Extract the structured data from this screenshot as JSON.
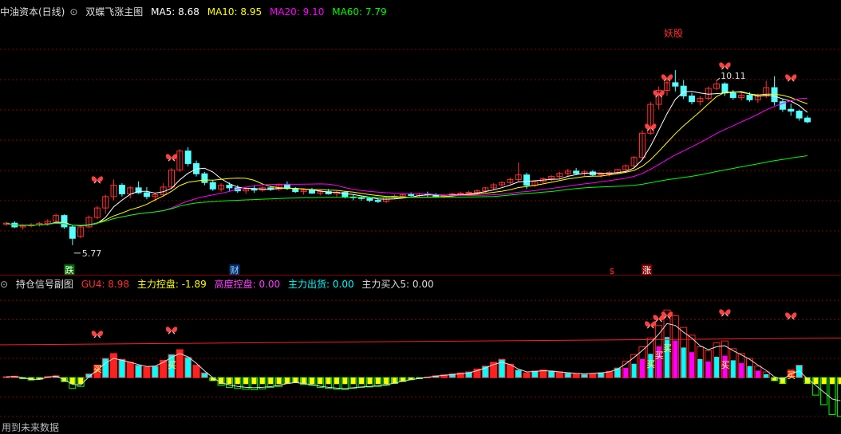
{
  "main_header": {
    "stock_name": "中油资本(日线)",
    "formula_name": "双蝶飞涨主图",
    "ma5": "MA5: 8.68",
    "ma10": "MA10: 8.95",
    "ma20": "MA20: 9.10",
    "ma60": "MA60: 7.79"
  },
  "sub_header": {
    "title": "持仓信号副图",
    "gu4": "GU4: 8.98",
    "ctrl": "主力控盘: -1.89",
    "high_ctrl": "高度控盘: 0.00",
    "ship": "主力出货: 0.00",
    "buy5": "主力买入5: 0.00"
  },
  "annotations": {
    "demon": "妖股",
    "high_label": "10.11",
    "low_label": "5.77",
    "die": "跌",
    "cai": "财",
    "dollar": "$",
    "zhang": "涨",
    "buy": "买"
  },
  "footer_note": "用到未来数据",
  "colors": {
    "up": "#ff3030",
    "down": "#54ffff",
    "ma5": "#ffffff",
    "ma10": "#ffff00",
    "ma20": "#ff00ff",
    "ma60": "#00ff00",
    "grid": "#8b0000",
    "butterfly": "#ff4040",
    "pos_bar": "#ff2020",
    "neg_bar": "#ffff00",
    "neg_outline": "#00ff00",
    "magenta_bar": "#ff00ff",
    "cyan_bar": "#00ffff"
  },
  "chart_data": [
    {
      "type": "candlestick",
      "title": "双蝶飞涨主图",
      "series_names": [
        "MA5",
        "MA10",
        "MA20",
        "MA60"
      ],
      "ylim": [
        5.2,
        11.6
      ],
      "high_marker": 10.11,
      "low_marker": 5.77,
      "candles": [
        [
          6.32,
          6.38,
          6.28,
          6.35
        ],
        [
          6.35,
          6.4,
          6.22,
          6.25
        ],
        [
          6.25,
          6.32,
          6.18,
          6.28
        ],
        [
          6.28,
          6.35,
          6.24,
          6.3
        ],
        [
          6.3,
          6.38,
          6.26,
          6.34
        ],
        [
          6.34,
          6.45,
          6.28,
          6.4
        ],
        [
          6.4,
          6.6,
          6.36,
          6.55
        ],
        [
          6.55,
          6.58,
          6.2,
          6.25
        ],
        [
          6.25,
          6.3,
          5.77,
          5.95
        ],
        [
          6.0,
          6.3,
          5.95,
          6.25
        ],
        [
          6.25,
          6.55,
          6.22,
          6.5
        ],
        [
          6.5,
          6.8,
          6.45,
          6.75
        ],
        [
          6.75,
          7.1,
          6.6,
          7.05
        ],
        [
          7.05,
          7.5,
          6.95,
          7.35
        ],
        [
          7.35,
          7.4,
          7.05,
          7.12
        ],
        [
          7.12,
          7.32,
          7.0,
          7.28
        ],
        [
          7.28,
          7.45,
          7.12,
          7.15
        ],
        [
          7.15,
          7.3,
          6.98,
          7.05
        ],
        [
          7.05,
          7.15,
          6.92,
          7.1
        ],
        [
          7.1,
          7.4,
          7.05,
          7.3
        ],
        [
          7.3,
          7.8,
          7.25,
          7.75
        ],
        [
          7.75,
          8.3,
          7.7,
          8.25
        ],
        [
          8.25,
          8.35,
          7.85,
          7.92
        ],
        [
          7.92,
          8.0,
          7.58,
          7.65
        ],
        [
          7.65,
          7.7,
          7.35,
          7.42
        ],
        [
          7.42,
          7.48,
          7.2,
          7.25
        ],
        [
          7.25,
          7.4,
          7.18,
          7.35
        ],
        [
          7.35,
          7.42,
          7.2,
          7.28
        ],
        [
          7.28,
          7.35,
          7.15,
          7.2
        ],
        [
          7.2,
          7.3,
          7.12,
          7.25
        ],
        [
          7.25,
          7.35,
          7.15,
          7.22
        ],
        [
          7.22,
          7.32,
          7.18,
          7.28
        ],
        [
          7.28,
          7.34,
          7.2,
          7.24
        ],
        [
          7.24,
          7.4,
          7.2,
          7.36
        ],
        [
          7.36,
          7.45,
          7.22,
          7.26
        ],
        [
          7.26,
          7.3,
          7.15,
          7.18
        ],
        [
          7.18,
          7.26,
          7.1,
          7.22
        ],
        [
          7.22,
          7.28,
          7.12,
          7.14
        ],
        [
          7.14,
          7.22,
          7.08,
          7.18
        ],
        [
          7.18,
          7.25,
          7.1,
          7.12
        ],
        [
          7.12,
          7.2,
          7.05,
          7.16
        ],
        [
          7.16,
          7.2,
          7.0,
          7.04
        ],
        [
          7.04,
          7.1,
          6.95,
          7.02
        ],
        [
          7.02,
          7.06,
          6.94,
          7.0
        ],
        [
          7.0,
          7.04,
          6.9,
          6.95
        ],
        [
          6.95,
          7.0,
          6.88,
          6.92
        ],
        [
          6.92,
          7.05,
          6.88,
          7.02
        ],
        [
          7.02,
          7.1,
          6.98,
          7.06
        ],
        [
          7.06,
          7.12,
          7.0,
          7.1
        ],
        [
          7.1,
          7.16,
          7.04,
          7.08
        ],
        [
          7.08,
          7.15,
          7.02,
          7.12
        ],
        [
          7.12,
          7.18,
          7.05,
          7.1
        ],
        [
          7.1,
          7.14,
          7.02,
          7.06
        ],
        [
          7.06,
          7.12,
          7.0,
          7.08
        ],
        [
          7.08,
          7.15,
          7.04,
          7.12
        ],
        [
          7.12,
          7.18,
          7.06,
          7.14
        ],
        [
          7.14,
          7.2,
          7.08,
          7.16
        ],
        [
          7.16,
          7.24,
          7.1,
          7.2
        ],
        [
          7.2,
          7.3,
          7.15,
          7.28
        ],
        [
          7.28,
          7.4,
          7.22,
          7.36
        ],
        [
          7.36,
          7.45,
          7.3,
          7.42
        ],
        [
          7.42,
          7.55,
          7.38,
          7.5
        ],
        [
          7.5,
          7.95,
          7.45,
          7.62
        ],
        [
          7.62,
          7.68,
          7.25,
          7.35
        ],
        [
          7.35,
          7.48,
          7.3,
          7.44
        ],
        [
          7.44,
          7.56,
          7.4,
          7.52
        ],
        [
          7.52,
          7.62,
          7.45,
          7.58
        ],
        [
          7.58,
          7.7,
          7.52,
          7.66
        ],
        [
          7.66,
          7.78,
          7.58,
          7.72
        ],
        [
          7.72,
          7.8,
          7.62,
          7.66
        ],
        [
          7.66,
          7.74,
          7.6,
          7.7
        ],
        [
          7.7,
          7.75,
          7.58,
          7.62
        ],
        [
          7.62,
          7.68,
          7.55,
          7.64
        ],
        [
          7.64,
          7.72,
          7.58,
          7.68
        ],
        [
          7.68,
          7.78,
          7.64,
          7.76
        ],
        [
          7.76,
          7.9,
          7.7,
          7.86
        ],
        [
          7.86,
          8.12,
          7.8,
          8.08
        ],
        [
          8.08,
          8.8,
          8.02,
          8.72
        ],
        [
          8.72,
          9.55,
          8.68,
          9.48
        ],
        [
          9.48,
          9.95,
          9.35,
          9.85
        ],
        [
          9.85,
          10.15,
          9.7,
          10.05
        ],
        [
          10.05,
          10.38,
          9.82,
          9.96
        ],
        [
          9.96,
          10.12,
          9.62,
          9.7
        ],
        [
          9.7,
          9.78,
          9.48,
          9.55
        ],
        [
          9.55,
          9.7,
          9.45,
          9.64
        ],
        [
          9.64,
          9.95,
          9.58,
          9.9
        ],
        [
          9.9,
          10.11,
          9.85,
          10.02
        ],
        [
          10.02,
          10.06,
          9.7,
          9.78
        ],
        [
          9.78,
          9.86,
          9.6,
          9.66
        ],
        [
          9.66,
          9.78,
          9.58,
          9.72
        ],
        [
          9.72,
          9.8,
          9.55,
          9.6
        ],
        [
          9.6,
          9.76,
          9.52,
          9.7
        ],
        [
          9.7,
          10.1,
          9.65,
          9.92
        ],
        [
          9.92,
          10.22,
          9.45,
          9.55
        ],
        [
          9.55,
          9.62,
          9.28,
          9.35
        ],
        [
          9.35,
          9.5,
          9.18,
          9.3
        ],
        [
          9.3,
          9.34,
          9.05,
          9.12
        ],
        [
          9.12,
          9.18,
          8.98,
          9.02
        ]
      ]
    },
    {
      "type": "bar",
      "title": "持仓信号副图",
      "series_names": [
        "GU4",
        "主力控盘",
        "高度控盘",
        "主力出货",
        "主力买入5"
      ],
      "ylim": [
        -25,
        45
      ],
      "values": [
        0.5,
        0.8,
        -0.5,
        -1.2,
        -0.8,
        0.6,
        1.0,
        -2.0,
        -5.5,
        -4.5,
        2.0,
        6.5,
        10.0,
        12.5,
        9.5,
        8.0,
        6.5,
        5.5,
        6.0,
        9.0,
        12.0,
        14.5,
        10.5,
        6.5,
        2.5,
        -1.5,
        -4.0,
        -5.0,
        -5.5,
        -6.0,
        -6.2,
        -5.8,
        -5.0,
        -4.5,
        -3.0,
        -2.5,
        -3.5,
        -4.0,
        -5.0,
        -5.5,
        -6.0,
        -6.2,
        -5.5,
        -5.0,
        -4.8,
        -4.5,
        -4.0,
        -3.0,
        -2.0,
        -1.0,
        -0.5,
        0.3,
        1.0,
        1.5,
        2.0,
        2.5,
        3.0,
        4.5,
        6.0,
        8.0,
        9.5,
        7.0,
        4.0,
        2.5,
        3.5,
        4.0,
        3.5,
        3.0,
        2.5,
        2.0,
        1.8,
        2.2,
        2.6,
        3.2,
        5.0,
        8.5,
        12.0,
        16.0,
        20.5,
        27.0,
        35.0,
        32.0,
        26.0,
        22.0,
        16.0,
        14.0,
        18.0,
        19.0,
        15.0,
        12.5,
        10.0,
        6.0,
        3.0,
        -1.5,
        -3.0,
        4.0,
        6.5,
        -3.0,
        -9.0,
        -14.0,
        -19.0,
        -20.0
      ],
      "gu4_line": [
        17.0,
        20.5
      ],
      "curve": [
        0.5,
        0.6,
        0.0,
        -0.8,
        -0.9,
        0.3,
        0.8,
        -1.0,
        -3.5,
        -3.8,
        0.5,
        4.0,
        7.5,
        10.0,
        9.0,
        8.0,
        6.8,
        5.8,
        6.0,
        8.0,
        10.5,
        12.5,
        10.8,
        7.5,
        3.5,
        0.0,
        -2.5,
        -3.8,
        -4.5,
        -5.0,
        -5.2,
        -5.0,
        -4.6,
        -4.0,
        -3.0,
        -2.5,
        -3.0,
        -3.6,
        -4.4,
        -5.0,
        -5.4,
        -5.6,
        -5.2,
        -4.8,
        -4.5,
        -4.2,
        -3.6,
        -2.8,
        -1.8,
        -1.0,
        -0.4,
        0.2,
        0.8,
        1.2,
        1.6,
        2.0,
        2.5,
        3.6,
        5.0,
        6.8,
        8.0,
        6.8,
        4.5,
        3.0,
        3.2,
        3.6,
        3.4,
        3.0,
        2.6,
        2.2,
        2.0,
        2.2,
        2.5,
        3.0,
        4.4,
        7.2,
        10.5,
        14.0,
        18.0,
        22.5,
        28.0,
        27.0,
        23.5,
        20.5,
        16.5,
        14.5,
        16.0,
        16.5,
        14.0,
        11.8,
        9.5,
        6.5,
        3.8,
        0.5,
        -1.0,
        2.0,
        3.5,
        -0.5,
        -4.0,
        -7.5,
        -11.0,
        -12.0
      ]
    }
  ]
}
